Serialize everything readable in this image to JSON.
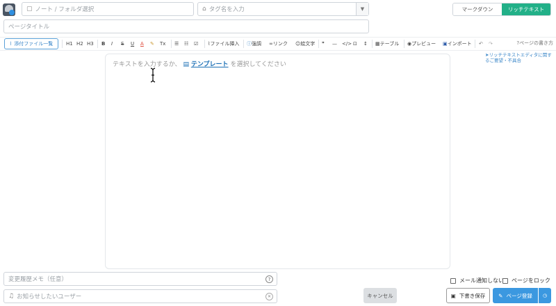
{
  "header": {
    "folder_placeholder": "ノート / フォルダ選択",
    "tag_placeholder": "タグ名を入力",
    "title_placeholder": "ページタイトル",
    "mode_markdown": "マークダウン",
    "mode_richtext": "リッチテキスト"
  },
  "toolbar": {
    "attach_label": "添付ファイル一覧",
    "h1": "H1",
    "h2": "H2",
    "h3": "H3",
    "bold": "B",
    "italic": "I",
    "strike": "S",
    "underline": "U",
    "color": "A",
    "clear": "Tx",
    "file_insert": "ファイル挿入",
    "emphasis": "強調",
    "link": "リンク",
    "emoji": "絵文字",
    "quote": "❞",
    "hr": "—",
    "code": "</>",
    "codeblock": "⊡",
    "expand": "↕",
    "table": "テーブル",
    "preview": "プレビュー",
    "import": "インポート",
    "undo": "↶",
    "redo": "↷",
    "howto": "ページの書き方"
  },
  "feedback_link": "リッチテキストエディタに関するご要望・不具合",
  "editor": {
    "placeholder_before": "テキストを入力するか、",
    "template_link": "テンプレート",
    "placeholder_after": "を選択してください"
  },
  "footer": {
    "memo_placeholder": "変更履歴メモ（任意）",
    "notify_placeholder": "お知らせしたいユーザー",
    "cancel": "キャンセル",
    "no_mail": "メール通知しない",
    "lock_page": "ページをロック",
    "draft": "下書き保存",
    "register": "ページ登録"
  },
  "colors": {
    "accent_green": "#22b088",
    "accent_blue": "#3b98e0",
    "link_blue": "#1b6fb5"
  }
}
